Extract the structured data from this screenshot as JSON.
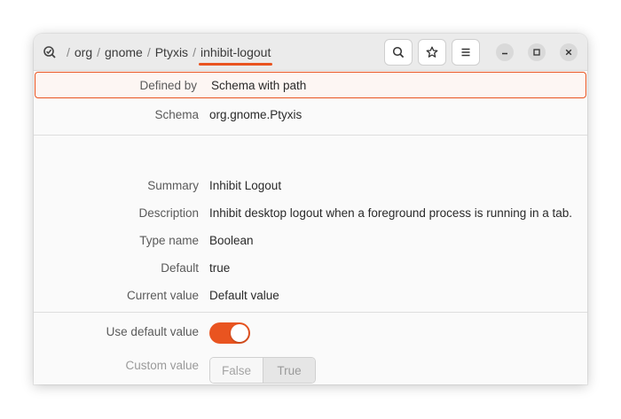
{
  "headerbar": {
    "path": [
      "org",
      "gnome",
      "Ptyxis",
      "inhibit-logout"
    ],
    "separator": "/",
    "icons": {
      "app": "checkmark-search-icon",
      "search": "search-icon",
      "bookmark": "star-icon",
      "menu": "hamburger-menu-icon",
      "minimize": "minimize-icon",
      "maximize": "maximize-icon",
      "close": "close-icon"
    }
  },
  "details": {
    "defined_by": {
      "label": "Defined by",
      "value": "Schema with path"
    },
    "schema": {
      "label": "Schema",
      "value": "org.gnome.Ptyxis"
    },
    "summary": {
      "label": "Summary",
      "value": "Inhibit Logout"
    },
    "description": {
      "label": "Description",
      "value": "Inhibit desktop logout when a foreground process is running in a tab."
    },
    "type_name": {
      "label": "Type name",
      "value": "Boolean"
    },
    "default": {
      "label": "Default",
      "value": "true"
    },
    "current_value": {
      "label": "Current value",
      "value": "Default value"
    }
  },
  "controls": {
    "use_default": {
      "label": "Use default value",
      "on": true
    },
    "custom_value": {
      "label": "Custom value",
      "options": [
        "False",
        "True"
      ],
      "selected": "True",
      "disabled": true
    }
  },
  "colors": {
    "accent": "#e95420"
  }
}
